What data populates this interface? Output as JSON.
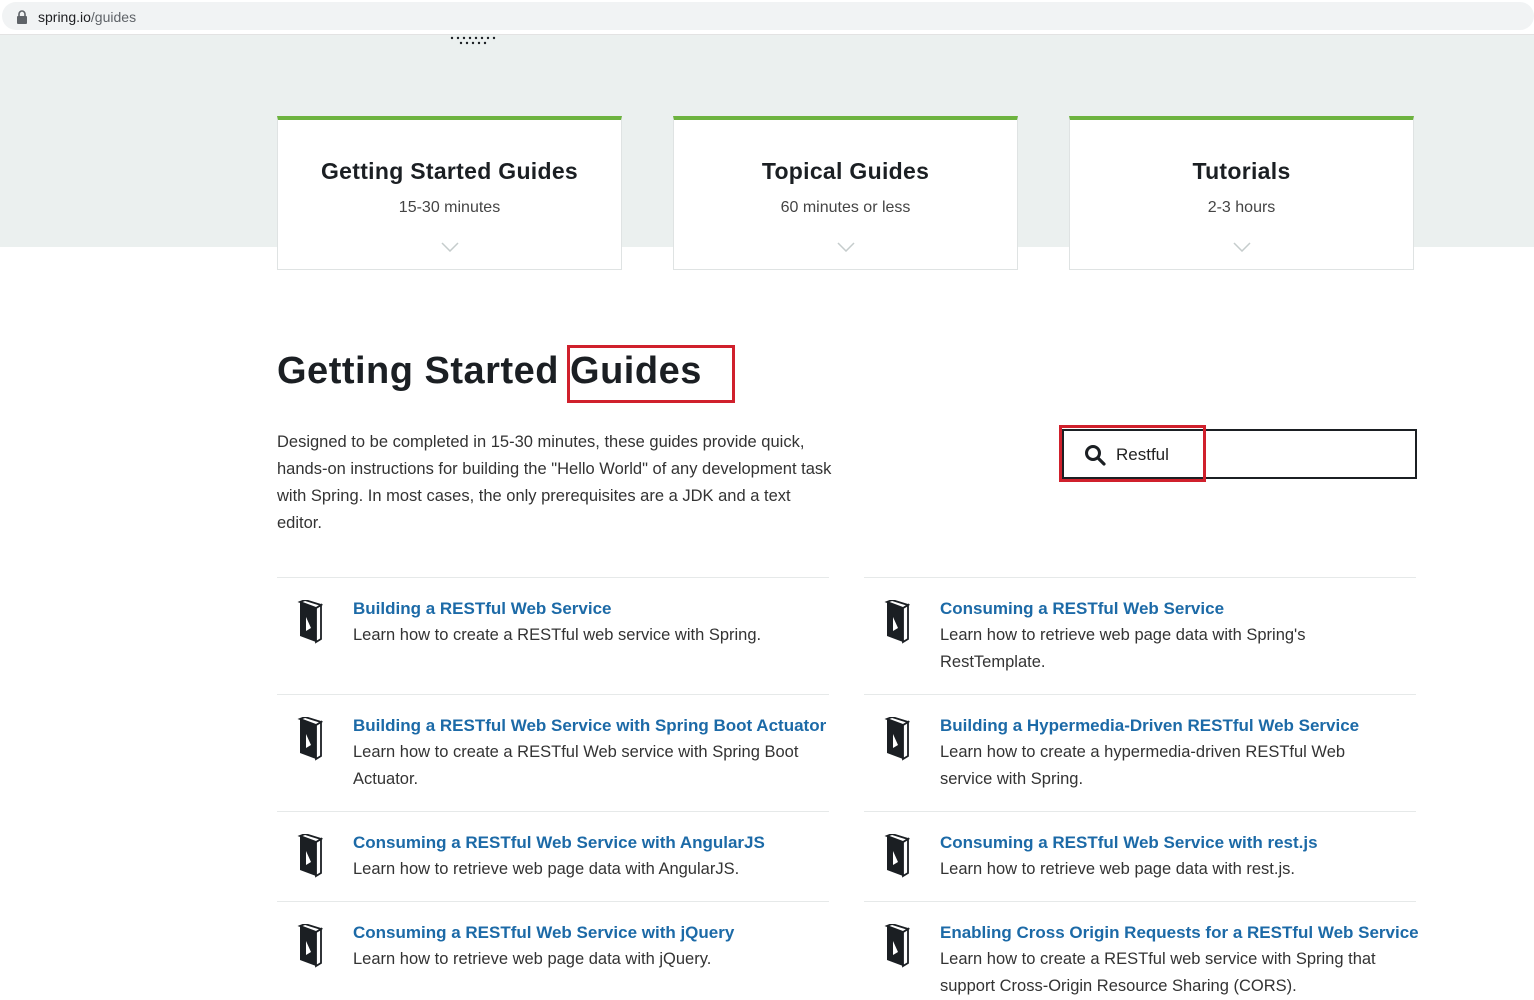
{
  "browser": {
    "url_host": "spring.io",
    "url_path": "/guides"
  },
  "cards": [
    {
      "title": "Getting Started Guides",
      "subtitle": "15-30 minutes"
    },
    {
      "title": "Topical Guides",
      "subtitle": "60 minutes or less"
    },
    {
      "title": "Tutorials",
      "subtitle": "2-3 hours"
    }
  ],
  "section": {
    "title_part1": "Getting Started",
    "title_part2": "Guides",
    "description": "Designed to be completed in 15-30 minutes, these guides provide quick, hands-on instructions for building the \"Hello World\" of any development task with Spring. In most cases, the only prerequisites are a JDK and a text editor."
  },
  "search": {
    "value": "Restful"
  },
  "guides": [
    {
      "title": "Building a RESTful Web Service",
      "description": "Learn how to create a RESTful web service with Spring."
    },
    {
      "title": "Consuming a RESTful Web Service",
      "description": "Learn how to retrieve web page data with Spring's RestTemplate."
    },
    {
      "title": "Building a RESTful Web Service with Spring Boot Actuator",
      "description": "Learn how to create a RESTful Web service with Spring Boot Actuator."
    },
    {
      "title": "Building a Hypermedia-Driven RESTful Web Service",
      "description": "Learn how to create a hypermedia-driven RESTful Web service with Spring."
    },
    {
      "title": "Consuming a RESTful Web Service with AngularJS",
      "description": "Learn how to retrieve web page data with AngularJS."
    },
    {
      "title": "Consuming a RESTful Web Service with rest.js",
      "description": "Learn how to retrieve web page data with rest.js."
    },
    {
      "title": "Consuming a RESTful Web Service with jQuery",
      "description": "Learn how to retrieve web page data with jQuery."
    },
    {
      "title": "Enabling Cross Origin Requests for a RESTful Web Service",
      "description": "Learn how to create a RESTful web service with Spring that support Cross-Origin Resource Sharing (CORS)."
    }
  ],
  "colors": {
    "accent_green": "#6db33f",
    "link_blue": "#1c6aa7",
    "highlight_red": "#d0202c",
    "hero_bg": "#ebf0ef"
  }
}
